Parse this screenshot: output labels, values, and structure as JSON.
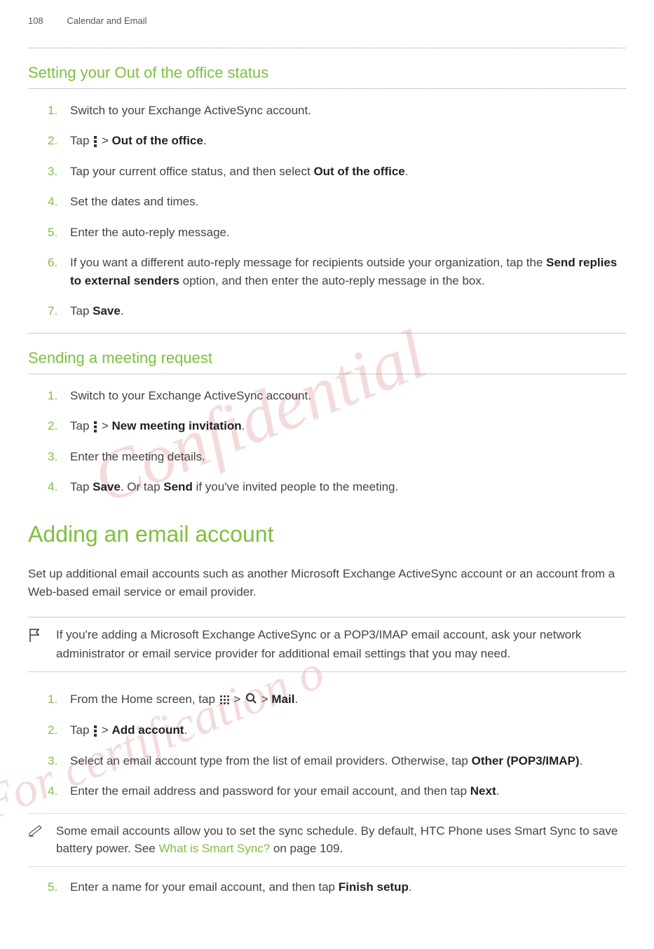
{
  "header": {
    "page_num": "108",
    "chapter": "Calendar and Email"
  },
  "section1": {
    "title": "Setting your Out of the office status",
    "steps": [
      {
        "text": "Switch to your Exchange ActiveSync account."
      },
      {
        "pre": "Tap ",
        "icon": "menu",
        "post": " > ",
        "bold": "Out of the office",
        "tail": "."
      },
      {
        "pre": "Tap your current office status, and then select ",
        "bold": "Out of the office",
        "tail": "."
      },
      {
        "text": "Set the dates and times."
      },
      {
        "text": "Enter the auto-reply message."
      },
      {
        "pre": "If you want a different auto-reply message for recipients outside your organization, tap the ",
        "bold": "Send replies to external senders",
        "tail": " option, and then enter the auto-reply message in the box."
      },
      {
        "pre": "Tap ",
        "bold": "Save",
        "tail": "."
      }
    ]
  },
  "section2": {
    "title": "Sending a meeting request",
    "steps": [
      {
        "text": "Switch to your Exchange ActiveSync account."
      },
      {
        "pre": "Tap ",
        "icon": "menu",
        "post": " > ",
        "bold": "New meeting invitation",
        "tail": "."
      },
      {
        "text": "Enter the meeting details."
      },
      {
        "pre": "Tap ",
        "bold": "Save",
        "tail": ". Or tap ",
        "bold2": "Send",
        "tail2": " if you've invited people to the meeting."
      }
    ]
  },
  "section3": {
    "heading": "Adding an email account",
    "intro": "Set up additional email accounts such as another Microsoft Exchange ActiveSync account or an account from a Web-based email service or email provider.",
    "info": "If you're adding a Microsoft Exchange ActiveSync or a POP3/IMAP email account, ask your network administrator or email service provider for additional email settings that you may need.",
    "steps": [
      {
        "pre": "From the Home screen, tap ",
        "icon": "apps",
        "post": " > ",
        "icon2": "search",
        "post2": " > ",
        "bold": "Mail",
        "tail": "."
      },
      {
        "pre": "Tap ",
        "icon": "menu",
        "post": " > ",
        "bold": "Add account",
        "tail": "."
      },
      {
        "pre": "Select an email account type from the list of email providers. Otherwise, tap ",
        "bold": "Other (POP3/IMAP)",
        "tail": "."
      },
      {
        "pre": "Enter the email address and password for your email account, and then tap ",
        "bold": "Next",
        "tail": "."
      }
    ],
    "tip_pre": "Some email accounts allow you to set the sync schedule. By default, HTC Phone uses Smart Sync to save battery power. See ",
    "tip_link": "What is Smart Sync?",
    "tip_tail": " on page 109.",
    "step5_pre": "Enter a name for your email account, and then tap ",
    "step5_bold": "Finish setup",
    "step5_tail": "."
  },
  "watermarks": {
    "wm1": "Confidential",
    "wm2": "For certification o"
  }
}
